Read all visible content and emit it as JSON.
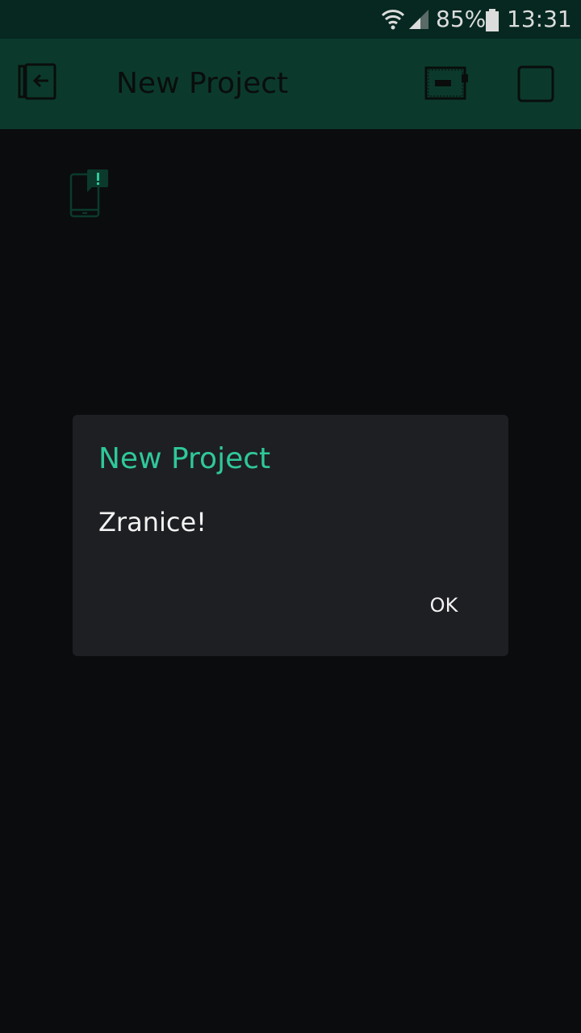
{
  "status_bar": {
    "battery_percent": "85%",
    "time": "13:31",
    "icons": [
      "wifi-icon",
      "cell-signal-icon",
      "battery-icon"
    ]
  },
  "toolbar": {
    "title": "New Project",
    "icons": [
      "exit-icon",
      "device-icon",
      "play-icon"
    ]
  },
  "canvas": {
    "icons": [
      "device-notification-icon"
    ]
  },
  "dialog": {
    "title": "New Project",
    "message": "Zranice!",
    "ok_label": "OK"
  },
  "colors": {
    "status_bar_bg": "#062820",
    "toolbar_bg": "#0b3a2c",
    "canvas_bg": "#0b0c0e",
    "dialog_bg": "#1e1f23",
    "accent": "#2fc89a"
  }
}
